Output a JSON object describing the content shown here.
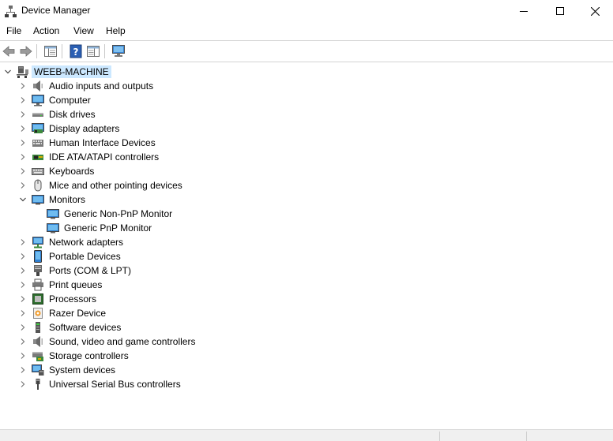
{
  "window": {
    "title": "Device Manager"
  },
  "menu": [
    "File",
    "Action",
    "View",
    "Help"
  ],
  "tree": {
    "root": "WEEB-MACHINE",
    "items": [
      {
        "label": "Audio inputs and outputs",
        "icon": "speaker-icon",
        "expanded": false,
        "children": []
      },
      {
        "label": "Computer",
        "icon": "computer-icon",
        "expanded": false,
        "children": []
      },
      {
        "label": "Disk drives",
        "icon": "disk-drive-icon",
        "expanded": false,
        "children": []
      },
      {
        "label": "Display adapters",
        "icon": "display-adapter-icon",
        "expanded": false,
        "children": []
      },
      {
        "label": "Human Interface Devices",
        "icon": "hid-icon",
        "expanded": false,
        "children": []
      },
      {
        "label": "IDE ATA/ATAPI controllers",
        "icon": "ide-controller-icon",
        "expanded": false,
        "children": []
      },
      {
        "label": "Keyboards",
        "icon": "keyboard-icon",
        "expanded": false,
        "children": []
      },
      {
        "label": "Mice and other pointing devices",
        "icon": "mouse-icon",
        "expanded": false,
        "children": []
      },
      {
        "label": "Monitors",
        "icon": "monitor-icon",
        "expanded": true,
        "children": [
          "Generic Non-PnP Monitor",
          "Generic PnP Monitor"
        ]
      },
      {
        "label": "Network adapters",
        "icon": "network-adapter-icon",
        "expanded": false,
        "children": []
      },
      {
        "label": "Portable Devices",
        "icon": "portable-device-icon",
        "expanded": false,
        "children": []
      },
      {
        "label": "Ports (COM & LPT)",
        "icon": "port-icon",
        "expanded": false,
        "children": []
      },
      {
        "label": "Print queues",
        "icon": "printer-icon",
        "expanded": false,
        "children": []
      },
      {
        "label": "Processors",
        "icon": "processor-icon",
        "expanded": false,
        "children": []
      },
      {
        "label": "Razer Device",
        "icon": "razer-device-icon",
        "expanded": false,
        "children": []
      },
      {
        "label": "Software devices",
        "icon": "software-device-icon",
        "expanded": false,
        "children": []
      },
      {
        "label": "Sound, video and game controllers",
        "icon": "sound-controller-icon",
        "expanded": false,
        "children": []
      },
      {
        "label": "Storage controllers",
        "icon": "storage-controller-icon",
        "expanded": false,
        "children": []
      },
      {
        "label": "System devices",
        "icon": "system-device-icon",
        "expanded": false,
        "children": []
      },
      {
        "label": "Universal Serial Bus controllers",
        "icon": "usb-icon",
        "expanded": false,
        "children": []
      }
    ]
  }
}
